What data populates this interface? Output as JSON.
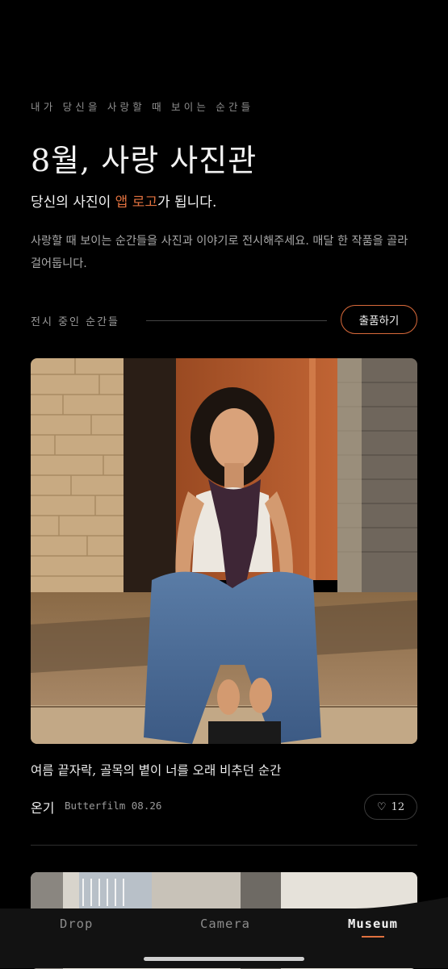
{
  "header": {
    "eyebrow": "내가 당신을 사랑할 때 보이는 순간들",
    "title": "8월, 사랑 사진관",
    "subtitle_prefix": "당신의 사진이 ",
    "subtitle_accent": "앱 로고",
    "subtitle_suffix": "가 됩니다.",
    "description": "사랑할 때 보이는 순간들을 사진과 이야기로 전시해주세요. 매달 한 작품을 골라 걸어둡니다."
  },
  "section": {
    "label": "전시 중인 순간들",
    "submit_label": "출품하기"
  },
  "cards": [
    {
      "caption": "여름 끝자락, 골목의 볕이 너를 오래 비추던 순간",
      "author": "온기",
      "camera_date": "Butterfilm 08.26",
      "like_icon": "♡",
      "likes": "12"
    }
  ],
  "tabs": [
    {
      "label": "Drop"
    },
    {
      "label": "Camera"
    },
    {
      "label": "Museum"
    }
  ],
  "colors": {
    "accent": "#e0713f",
    "background": "#000000"
  }
}
